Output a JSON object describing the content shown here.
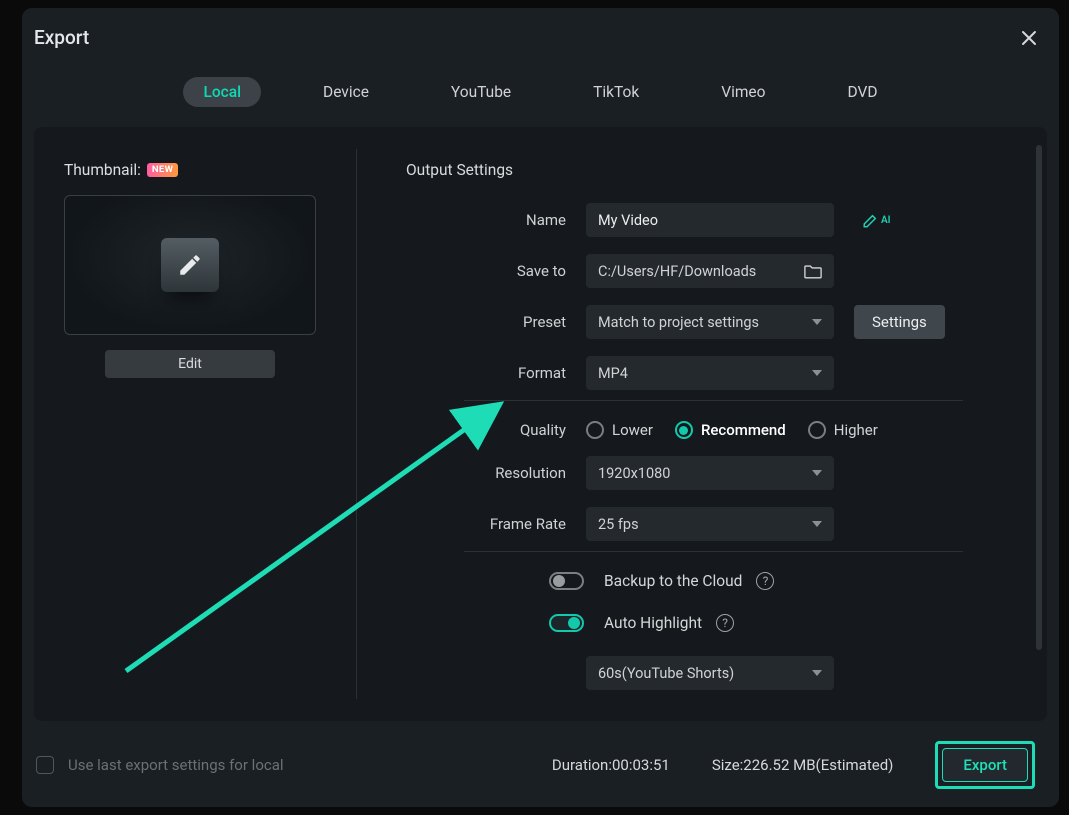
{
  "title": "Export",
  "tabs": [
    "Local",
    "Device",
    "YouTube",
    "TikTok",
    "Vimeo",
    "DVD"
  ],
  "active_tab": "Local",
  "thumbnail": {
    "label": "Thumbnail:",
    "badge": "NEW",
    "edit": "Edit"
  },
  "output": {
    "title": "Output Settings",
    "name_label": "Name",
    "name_value": "My Video",
    "saveto_label": "Save to",
    "saveto_value": "C:/Users/HF/Downloads",
    "preset_label": "Preset",
    "preset_value": "Match to project settings",
    "settings_btn": "Settings",
    "format_label": "Format",
    "format_value": "MP4",
    "quality_label": "Quality",
    "quality_options": {
      "lower": "Lower",
      "recommend": "Recommend",
      "higher": "Higher"
    },
    "quality_selected": "recommend",
    "resolution_label": "Resolution",
    "resolution_value": "1920x1080",
    "framerate_label": "Frame Rate",
    "framerate_value": "25 fps",
    "backup_label": "Backup to the Cloud",
    "backup_on": false,
    "highlight_label": "Auto Highlight",
    "highlight_on": true,
    "highlight_preset": "60s(YouTube Shorts)"
  },
  "footer": {
    "checkbox_label": "Use last export settings for local",
    "duration": "Duration:00:03:51",
    "size": "Size:226.52 MB(Estimated)",
    "export_btn": "Export"
  }
}
